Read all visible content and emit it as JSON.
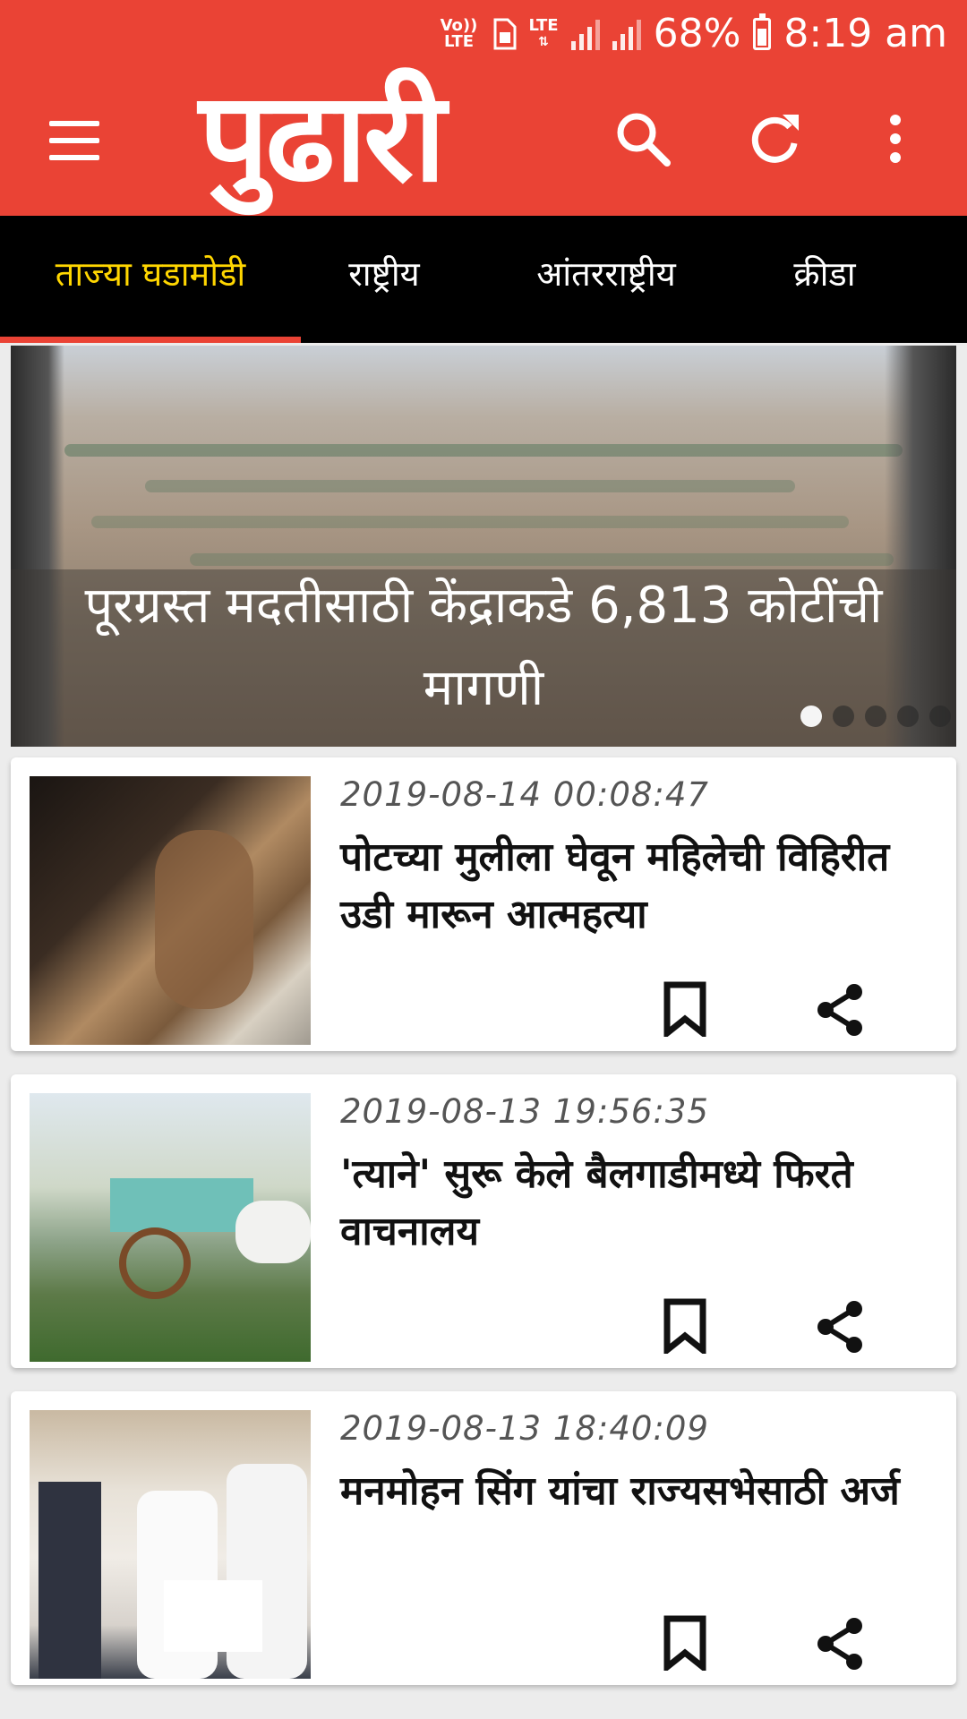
{
  "status_bar": {
    "volte": "Vo)) LTE",
    "lte": "LTE",
    "battery_percent": "68%",
    "time": "8:19 am"
  },
  "app_bar": {
    "logo_text": "पुढारी",
    "icons": [
      "menu-icon",
      "search-icon",
      "refresh-icon",
      "more-vert-icon"
    ],
    "background_color": "#ea4335"
  },
  "tabs": [
    {
      "label": "ताज्या घडामोडी",
      "active": true
    },
    {
      "label": "राष्ट्रीय",
      "active": false
    },
    {
      "label": "आंतरराष्ट्रीय",
      "active": false
    },
    {
      "label": "क्रीडा",
      "active": false
    }
  ],
  "hero": {
    "caption": "पूरग्रस्त मदतीसाठी केंद्राकडे 6,813 कोटींची मागणी",
    "slide_count": 5,
    "active_slide": 1
  },
  "articles": [
    {
      "timestamp": "2019-08-14 00:08:47",
      "title": "पोटच्या मुलीला घेवून महिलेची विहिरीत उडी मारून आत्महत्या"
    },
    {
      "timestamp": "2019-08-13 19:56:35",
      "title": "'त्याने' सुरू केले बैलगाडीमध्ये फिरते वाचनालय"
    },
    {
      "timestamp": "2019-08-13 18:40:09",
      "title": "मनमोहन सिंग यांचा राज्यसभेसाठी अर्ज"
    }
  ],
  "colors": {
    "accent": "#ea4335",
    "active_tab_text": "#ffd600",
    "tab_bar": "#000000"
  }
}
